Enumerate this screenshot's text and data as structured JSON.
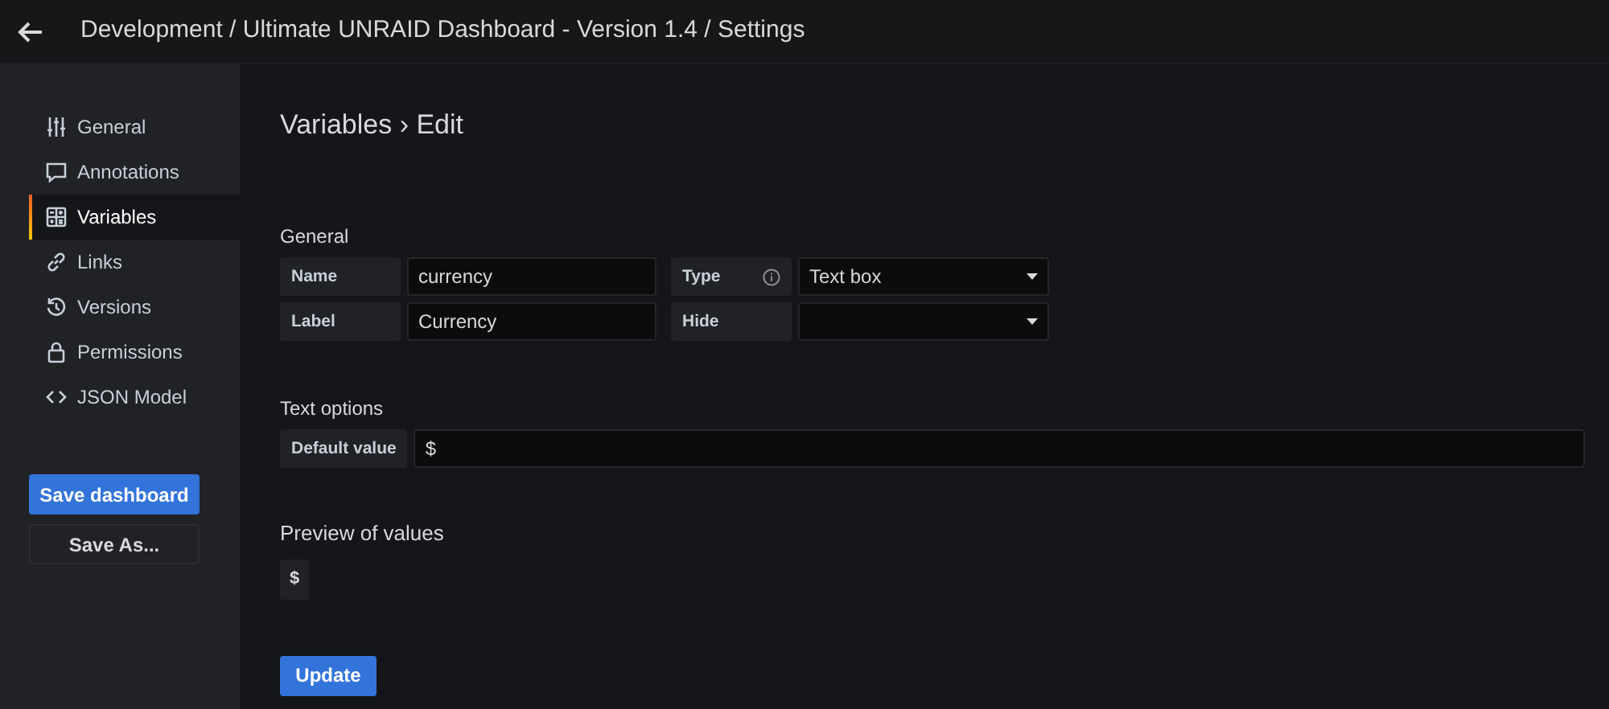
{
  "header": {
    "title": "Development / Ultimate UNRAID Dashboard - Version 1.4 / Settings"
  },
  "sidebar": {
    "items": [
      {
        "label": "General",
        "selected": false
      },
      {
        "label": "Annotations",
        "selected": false
      },
      {
        "label": "Variables",
        "selected": true
      },
      {
        "label": "Links",
        "selected": false
      },
      {
        "label": "Versions",
        "selected": false
      },
      {
        "label": "Permissions",
        "selected": false
      },
      {
        "label": "JSON Model",
        "selected": false
      }
    ],
    "buttons": [
      {
        "label": "Save dashboard",
        "kind": "primary"
      },
      {
        "label": "Save As...",
        "kind": "secondary"
      }
    ]
  },
  "page_title": "Variables › Edit",
  "general": {
    "heading": "General",
    "rows": [
      [
        {
          "label": "Name",
          "kind": "input",
          "value": "currency"
        },
        {
          "label": "Type",
          "kind": "select",
          "value": "Text box",
          "info": true
        }
      ],
      [
        {
          "label": "Label",
          "kind": "input",
          "value": "Currency"
        },
        {
          "label": "Hide",
          "kind": "select",
          "info": false
        }
      ]
    ]
  },
  "text_options": {
    "heading": "Text options",
    "label": "Default value",
    "value": "$"
  },
  "preview": {
    "heading": "Preview of values",
    "values": [
      "$"
    ]
  },
  "update_button": "Update"
}
